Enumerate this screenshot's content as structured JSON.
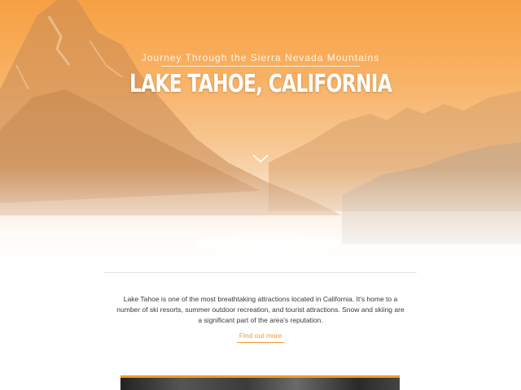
{
  "hero": {
    "eyebrow": "Journey Through the Sierra Nevada Mountains",
    "title": "LAKE TAHOE, CALIFORNIA",
    "scroll_icon": "chevron-down-icon"
  },
  "intro": {
    "text": "Lake Tahoe is one of the most breathtaking attractions located in California. It's home to a number of ski resorts, summer outdoor recreation, and tourist attractions. Snow and skiing are a significant part of the area's reputation.",
    "link_label": "Find out more"
  },
  "colors": {
    "accent": "#f39a2f",
    "hero_top": "#f7a043",
    "text": "#3a3a3a"
  }
}
